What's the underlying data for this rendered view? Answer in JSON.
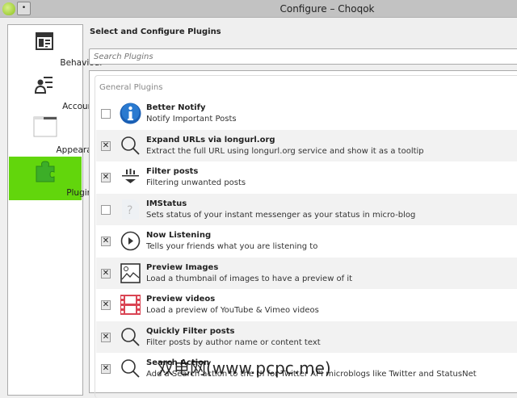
{
  "window": {
    "title": "Configure – Choqok",
    "menu_button": "•"
  },
  "sidebar": {
    "items": [
      {
        "label": "Behaviour",
        "icon": "behaviour-icon"
      },
      {
        "label": "Accounts",
        "icon": "accounts-icon"
      },
      {
        "label": "Appearance",
        "icon": "appearance-icon"
      },
      {
        "label": "Plugins",
        "icon": "plugins-icon",
        "selected": true
      }
    ]
  },
  "main": {
    "heading": "Select and Configure Plugins",
    "search": {
      "placeholder": "Search Plugins",
      "value": ""
    },
    "group_label": "General Plugins",
    "plugins": [
      {
        "name": "Better Notify",
        "desc": "Notify Important Posts",
        "checked": false,
        "icon": "info"
      },
      {
        "name": "Expand URLs via longurl.org",
        "desc": "Extract the full URL using longurl.org service and show it as a tooltip",
        "checked": true,
        "icon": "search"
      },
      {
        "name": "Filter posts",
        "desc": "Filtering unwanted posts",
        "checked": true,
        "icon": "filter"
      },
      {
        "name": "IMStatus",
        "desc": "Sets status of your instant messenger as your status in micro-blog",
        "checked": false,
        "icon": "unknown"
      },
      {
        "name": "Now Listening",
        "desc": "Tells your friends what you are listening to",
        "checked": true,
        "icon": "play"
      },
      {
        "name": "Preview Images",
        "desc": "Load a thumbnail of images to have a preview of it",
        "checked": true,
        "icon": "image"
      },
      {
        "name": "Preview videos",
        "desc": "Load a preview of YouTube & Vimeo videos",
        "checked": true,
        "icon": "film"
      },
      {
        "name": "Quickly Filter posts",
        "desc": "Filter posts by author name or content text",
        "checked": true,
        "icon": "search"
      },
      {
        "name": "Search Action",
        "desc": "Add a Search action to the UI for Twitter API microblogs like Twitter and StatusNet",
        "checked": true,
        "icon": "search"
      }
    ]
  },
  "watermark": "双电网(www.pcpc.me)"
}
